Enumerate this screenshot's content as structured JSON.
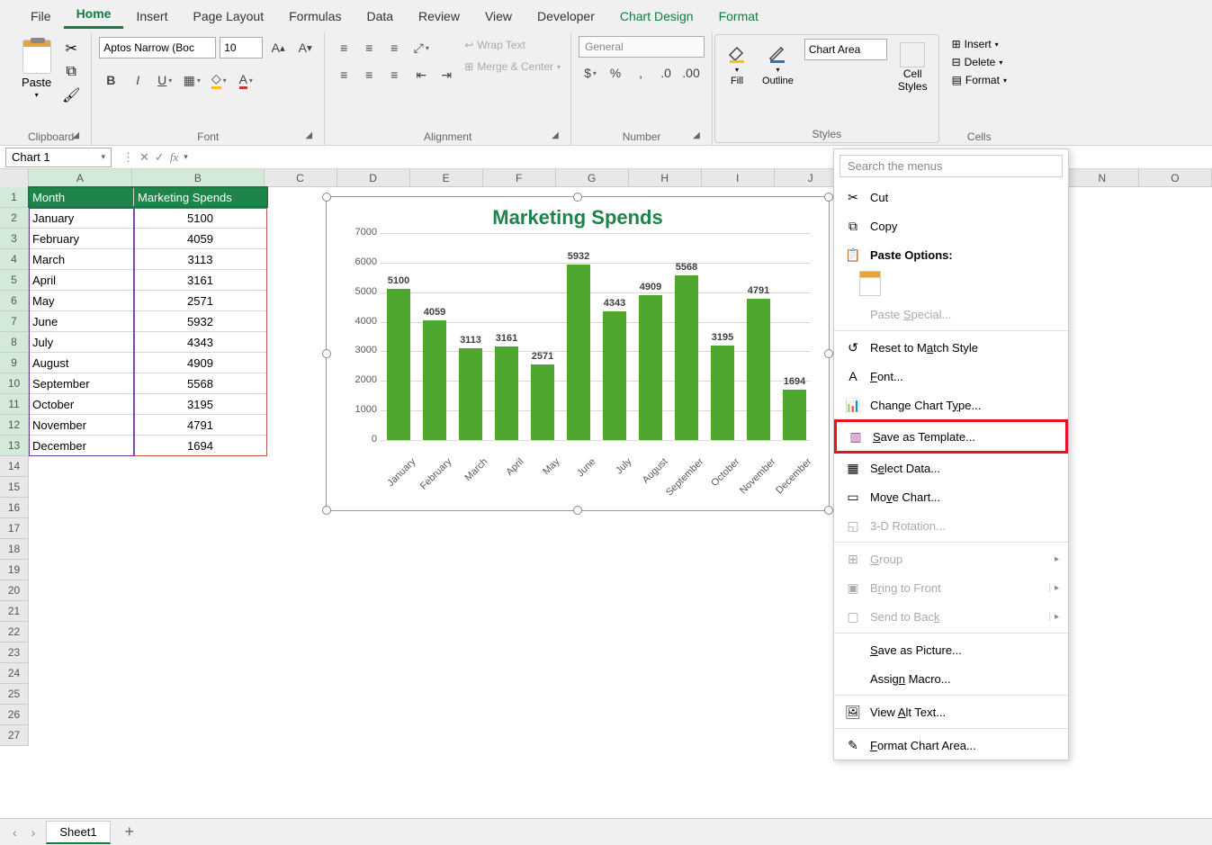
{
  "ribbon_tabs": [
    "File",
    "Home",
    "Insert",
    "Page Layout",
    "Formulas",
    "Data",
    "Review",
    "View",
    "Developer",
    "Chart Design",
    "Format"
  ],
  "active_tab": "Home",
  "clipboard": {
    "label": "Clipboard",
    "paste": "Paste"
  },
  "font": {
    "label": "Font",
    "name": "Aptos Narrow (Boc",
    "size": "10"
  },
  "alignment": {
    "label": "Alignment",
    "wrap": "Wrap Text",
    "merge": "Merge & Center"
  },
  "number": {
    "label": "Number",
    "format": "General"
  },
  "styles": {
    "label": "Styles",
    "fill": "Fill",
    "outline": "Outline",
    "chart_element": "Chart Area",
    "cell_styles": "Cell\nStyles"
  },
  "cells": {
    "label": "Cells",
    "insert": "Insert",
    "delete": "Delete",
    "format": "Format"
  },
  "name_box": "Chart 1",
  "col_widths": {
    "A": 117,
    "B": 148,
    "rest": 82
  },
  "columns": [
    "A",
    "B",
    "C",
    "D",
    "E",
    "F",
    "G",
    "H",
    "I",
    "N"
  ],
  "row_count": 27,
  "table": {
    "headers": [
      "Month",
      "Marketing Spends"
    ],
    "rows": [
      [
        "January",
        "5100"
      ],
      [
        "February",
        "4059"
      ],
      [
        "March",
        "3113"
      ],
      [
        "April",
        "3161"
      ],
      [
        "May",
        "2571"
      ],
      [
        "June",
        "5932"
      ],
      [
        "July",
        "4343"
      ],
      [
        "August",
        "4909"
      ],
      [
        "September",
        "5568"
      ],
      [
        "October",
        "3195"
      ],
      [
        "November",
        "4791"
      ],
      [
        "December",
        "1694"
      ]
    ]
  },
  "chart_data": {
    "type": "bar",
    "title": "Marketing Spends",
    "categories": [
      "January",
      "February",
      "March",
      "April",
      "May",
      "June",
      "July",
      "August",
      "September",
      "October",
      "November",
      "December"
    ],
    "values": [
      5100,
      4059,
      3113,
      3161,
      2571,
      5932,
      4343,
      4909,
      5568,
      3195,
      4791,
      1694
    ],
    "ylim": [
      0,
      7000
    ],
    "ytick": 1000,
    "xlabel": "",
    "ylabel": ""
  },
  "context_menu": {
    "search_placeholder": "Search the menus",
    "cut": "Cut",
    "copy": "Copy",
    "paste_options": "Paste Options:",
    "paste_special": "Paste Special...",
    "reset": "Reset to Match Style",
    "font": "Font...",
    "change_chart": "Change Chart Type...",
    "save_template": "Save as Template...",
    "select_data": "Select Data...",
    "move_chart": "Move Chart...",
    "rotation": "3-D Rotation...",
    "group": "Group",
    "bring_front": "Bring to Front",
    "send_back": "Send to Back",
    "save_picture": "Save as Picture...",
    "assign_macro": "Assign Macro...",
    "alt_text": "View Alt Text...",
    "format_chart": "Format Chart Area..."
  },
  "sheet": {
    "name": "Sheet1"
  }
}
